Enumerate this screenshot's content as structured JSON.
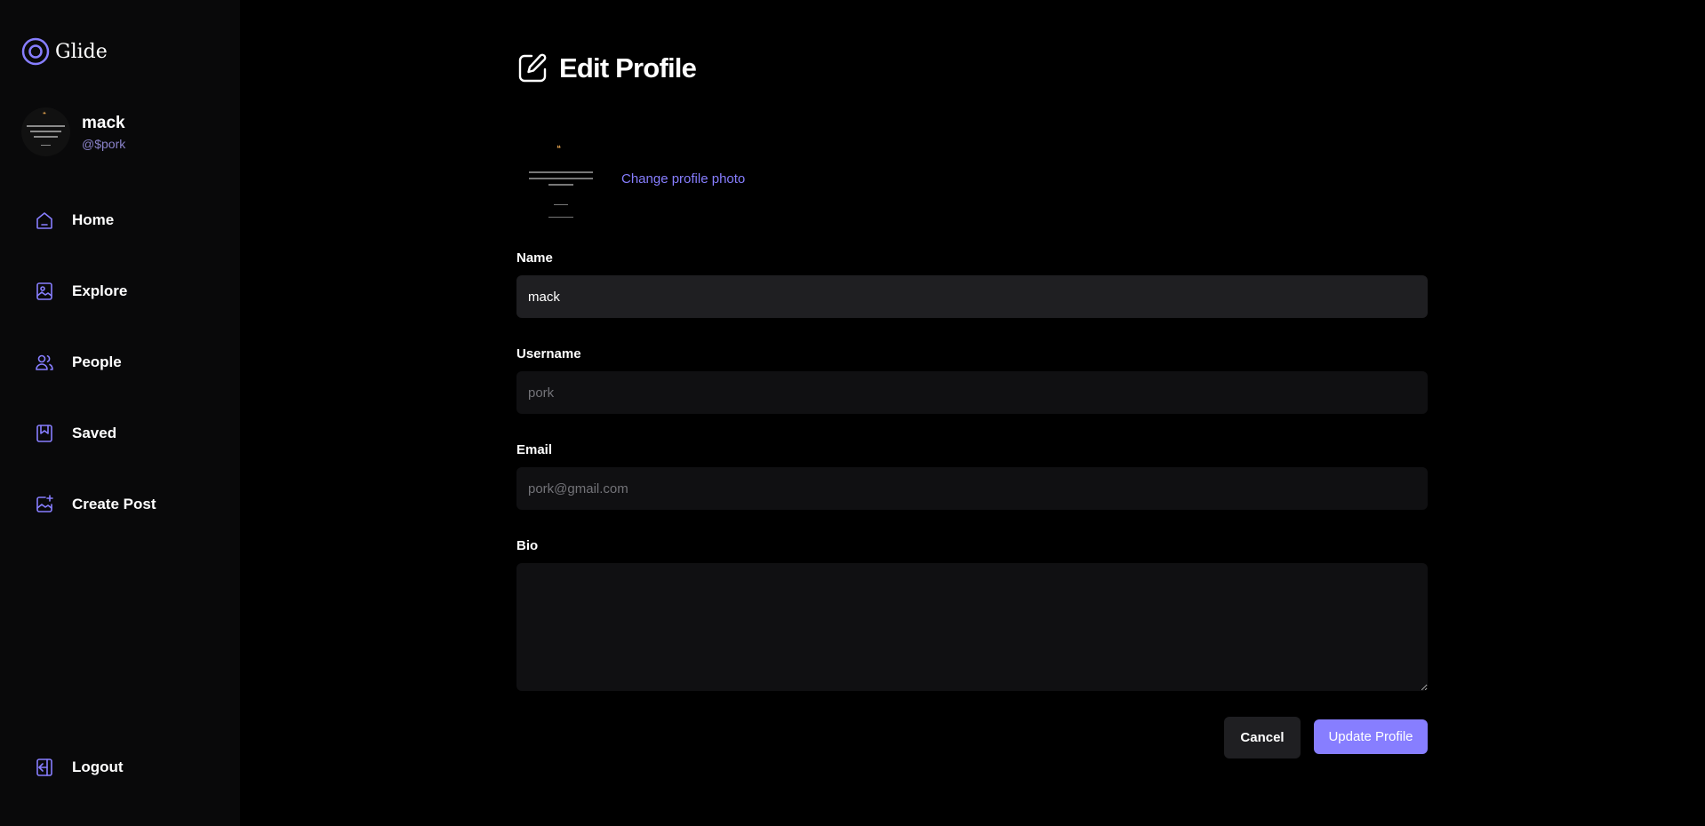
{
  "app": {
    "name": "Glide",
    "accent_color": "#877eff"
  },
  "user": {
    "name": "mack",
    "handle": "@$pork"
  },
  "sidebar": {
    "items": [
      {
        "label": "Home",
        "icon": "home-icon"
      },
      {
        "label": "Explore",
        "icon": "explore-icon"
      },
      {
        "label": "People",
        "icon": "people-icon"
      },
      {
        "label": "Saved",
        "icon": "saved-icon"
      },
      {
        "label": "Create Post",
        "icon": "create-post-icon"
      }
    ],
    "logout_label": "Logout"
  },
  "main": {
    "title": "Edit Profile",
    "change_photo_label": "Change profile photo",
    "fields": {
      "name": {
        "label": "Name",
        "value": "mack"
      },
      "username": {
        "label": "Username",
        "value": "pork"
      },
      "email": {
        "label": "Email",
        "value": "pork@gmail.com"
      },
      "bio": {
        "label": "Bio",
        "value": ""
      }
    },
    "cancel_label": "Cancel",
    "update_label": "Update Profile"
  }
}
